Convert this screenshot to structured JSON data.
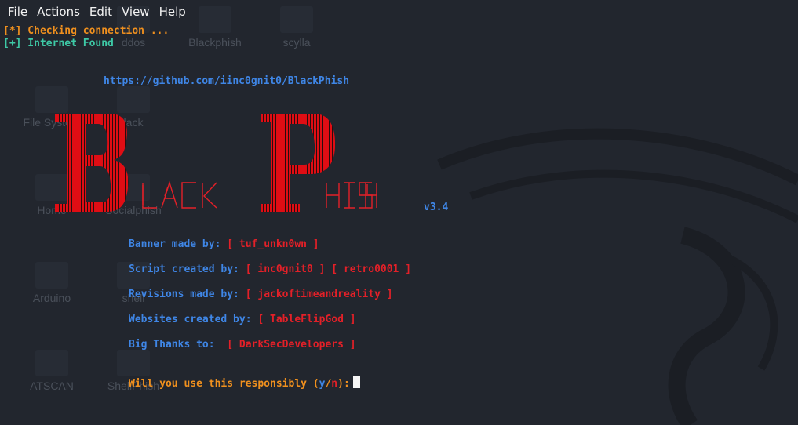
{
  "colors": {
    "background": "#22262e",
    "orange": "#f0901e",
    "green": "#3ec9a6",
    "blue": "#3f86e6",
    "red": "#e32028"
  },
  "menubar": {
    "items": [
      "File",
      "Actions",
      "Edit",
      "View",
      "Help"
    ]
  },
  "desktop": {
    "icons": [
      {
        "label": "ddos"
      },
      {
        "label": "Blackphish"
      },
      {
        "label": "scylla"
      },
      {
        "label": "File System"
      },
      {
        "label": "lack"
      },
      {
        "label": "Home"
      },
      {
        "label": "Socialphish"
      },
      {
        "label": "Arduino"
      },
      {
        "label": "shell"
      },
      {
        "label": "ATSCAN"
      },
      {
        "label": "ShellPhish"
      }
    ]
  },
  "terminal": {
    "status1": "[*] Checking connection ...",
    "status2": "[+] Internet Found",
    "url": "https://github.com/iinc0gnit0/BlackPhish",
    "logo_text": "BLACK PHISH",
    "version": "v3.4",
    "credits": [
      {
        "label": "Banner made by:",
        "value": "[ tuf_unkn0wn ]"
      },
      {
        "label": "Script created by:",
        "value": "[ inc0gnit0 ] [ retro0001 ]"
      },
      {
        "label": "Revisions made by:",
        "value": "[ jackoftimeandreality ]"
      },
      {
        "label": "Websites created by:",
        "value": "[ TableFlipGod ]"
      },
      {
        "label": "Big Thanks to:",
        "value": " [ DarkSecDevelopers ]"
      }
    ],
    "prompt": {
      "text": "Will you use this responsibly (",
      "yes": "y",
      "slash": "/",
      "no": "n",
      "end": "):"
    }
  }
}
